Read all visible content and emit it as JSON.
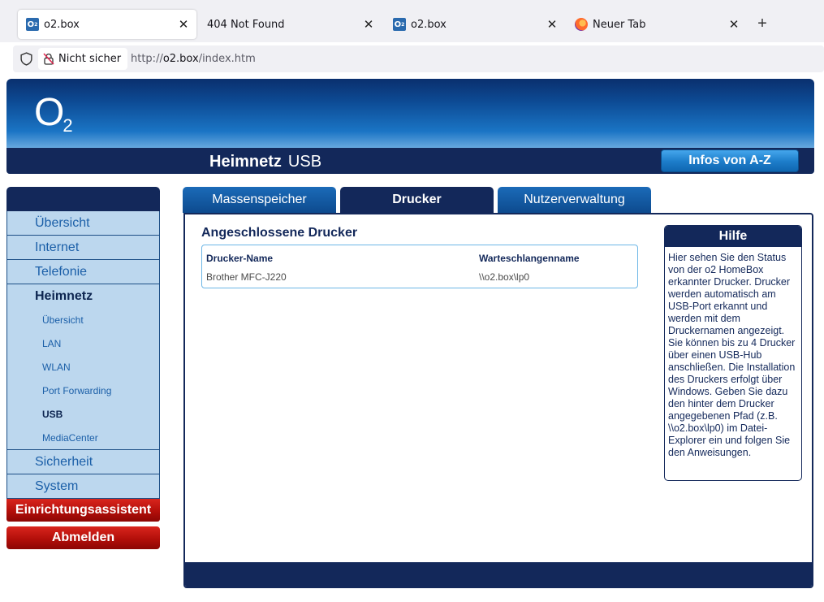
{
  "browser": {
    "tabs": [
      {
        "title": "o2.box",
        "icon": "o2-favicon-icon",
        "active": true
      },
      {
        "title": "404 Not Found",
        "icon": "",
        "active": false
      },
      {
        "title": "o2.box",
        "icon": "o2-favicon-icon",
        "active": false
      },
      {
        "title": "Neuer Tab",
        "icon": "firefox-icon",
        "active": false
      }
    ],
    "close_glyph": "✕",
    "new_tab_glyph": "+",
    "security_label": "Nicht sicher",
    "url_scheme": "http://",
    "url_host": "o2.box",
    "url_path": "/index.htm"
  },
  "header": {
    "logo": "O",
    "logo_sub": "2",
    "section": "Heimnetz",
    "page": "USB",
    "az_button": "Infos von A-Z"
  },
  "sidebar": {
    "main_items": [
      {
        "label": "Übersicht"
      },
      {
        "label": "Internet"
      },
      {
        "label": "Telefonie"
      },
      {
        "label": "Heimnetz",
        "selected": true
      }
    ],
    "sub_items": [
      {
        "label": "Übersicht"
      },
      {
        "label": "LAN"
      },
      {
        "label": "WLAN"
      },
      {
        "label": "Port Forwarding"
      },
      {
        "label": "USB",
        "selected": true
      },
      {
        "label": "MediaCenter"
      }
    ],
    "bottom_items": [
      {
        "label": "Sicherheit"
      },
      {
        "label": "System"
      }
    ],
    "wizard_button": "Einrichtungsassistent",
    "logout_button": "Abmelden"
  },
  "content_tabs": [
    {
      "label": "Massenspeicher",
      "active": false
    },
    {
      "label": "Drucker",
      "active": true
    },
    {
      "label": "Nutzerverwaltung",
      "active": false
    }
  ],
  "printers": {
    "title": "Angeschlossene Drucker",
    "columns": [
      "Drucker-Name",
      "Warteschlangenname"
    ],
    "rows": [
      [
        "Brother MFC-J220",
        "\\\\o2.box\\lp0"
      ]
    ]
  },
  "help": {
    "title": "Hilfe",
    "text": "Hier sehen Sie den Status von der o2 HomeBox erkannter Drucker. Drucker werden automatisch am USB-Port erkannt und werden mit dem Druckernamen angezeigt. Sie können bis zu 4 Drucker über einen USB-Hub anschließen. Die Installation des Druckers erfolgt über Windows. Geben Sie dazu den hinter dem Drucker angegebenen Pfad (z.B. \\\\o2.box\\lp0) im Datei-Explorer ein und folgen Sie den Anweisungen."
  },
  "colors": {
    "navy": "#13285a",
    "tab_blue": "#0d4a8e",
    "nav_bg": "#bcd7ee",
    "red": "#b30f0a"
  }
}
